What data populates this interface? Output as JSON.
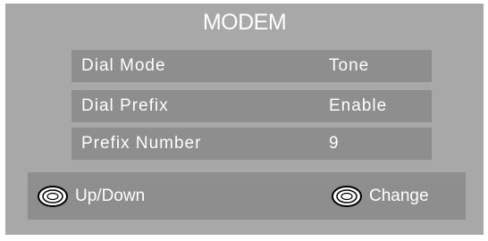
{
  "menu": {
    "title": "MODEM",
    "items": [
      {
        "label": "Dial Mode",
        "value": "Tone"
      },
      {
        "label": "Dial Prefix",
        "value": "Enable"
      },
      {
        "label": "Prefix Number",
        "value": "9"
      }
    ]
  },
  "help": {
    "navigate": {
      "icon": "remote-dpad-icon",
      "label": "Up/Down"
    },
    "change": {
      "icon": "remote-dpad-icon",
      "label": "Change"
    }
  },
  "colors": {
    "panel": "#a8a8a8",
    "row": "#8e8e8e",
    "text": "#ffffff"
  }
}
